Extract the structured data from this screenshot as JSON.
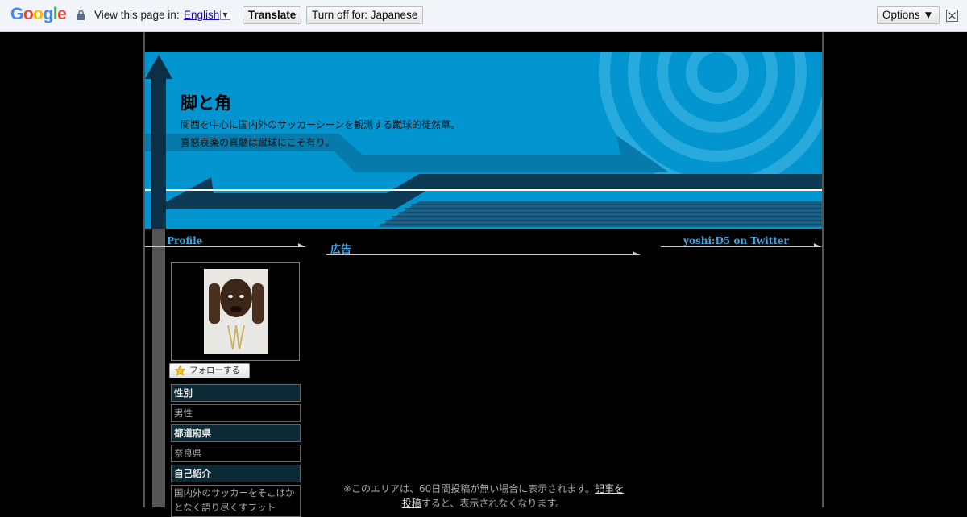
{
  "translate_bar": {
    "logo": "Google",
    "view_label": "View this page in:",
    "language": "English",
    "translate_button": "Translate",
    "turn_off_button": "Turn off for: Japanese",
    "options_button": "Options ▼"
  },
  "header": {
    "title": "脚と角",
    "description_1": "関西を中心に国内外のサッカーシーンを観測する蹴球的徒然草。",
    "description_2": "喜怒哀楽の真髄は蹴球にこそ有り。"
  },
  "sidebar": {
    "profile_heading": "Profile",
    "follow_button": "フォローする",
    "rows": [
      {
        "label": "性別",
        "value": "男性"
      },
      {
        "label": "都道府県",
        "value": "奈良県"
      },
      {
        "label": "自己紹介",
        "value": "国内外のサッカーをそこはかとなく語り尽くすフット"
      }
    ]
  },
  "main": {
    "ad_heading": "広告",
    "notice_text": "※このエリアは、60日間投稿が無い場合に表示されます。",
    "notice_link_1": "記事を",
    "notice_link_2": "投稿",
    "notice_tail": "すると、表示されなくなります。"
  },
  "right": {
    "twitter_heading": "yoshi:D5 on Twitter"
  },
  "colors": {
    "banner_blue": "#0395cf",
    "heading_blue": "#3fa8e8",
    "label_bg": "#0b2a35"
  }
}
